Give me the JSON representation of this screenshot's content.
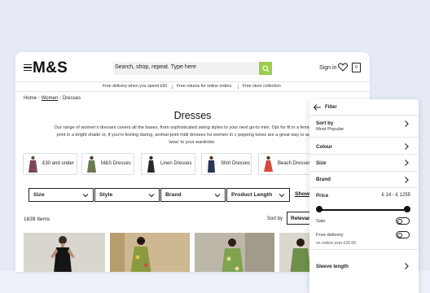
{
  "header": {
    "logo": "M&S",
    "search_placeholder": "Search, shop, repeat. Type here",
    "sign_in": "Sign in",
    "bag_count": "0"
  },
  "info_bar": [
    "Free delivery when you spend £60",
    "Free returns for online orders",
    "Free store collection"
  ],
  "breadcrumb": [
    "Home",
    "Women",
    "Dresses"
  ],
  "page": {
    "title": "Dresses",
    "description": "Our range of women's dresses covers all the bases, from sophisticated swing styles to your next go-to mini. Opt for fit in a feminine floral print in a bright shade or, if you're feeling daring, animal-print midi dresses for women in c popping tones are a great way to add a little 'wow' to your wardrobe"
  },
  "category_chips": [
    {
      "label": "£30 and under",
      "color": "#7a4a55"
    },
    {
      "label": "M&S Dresses",
      "color": "#6b7a4e"
    },
    {
      "label": "Linen Dresses",
      "color": "#2b2622"
    },
    {
      "label": "Shirt Dresses",
      "color": "#2a3556"
    },
    {
      "label": "Beach Dresses",
      "color": "#d84a3c"
    }
  ],
  "filters": [
    "Size",
    "Style",
    "Brand",
    "Product Length"
  ],
  "show_all_label": "Show",
  "results": {
    "count_text": "1839 Items",
    "sort_label": "Sort by",
    "sort_value": "Relevance"
  },
  "products": [
    {
      "color": "#c8c4bd"
    },
    {
      "color": "#c9b58f"
    },
    {
      "color": "#b8b2a6"
    },
    {
      "color": "#d7d2c8"
    }
  ],
  "filter_panel": {
    "title": "Filter",
    "sort_by_label": "Sort by",
    "sort_by_value": "Most Popular",
    "colour_label": "Colour",
    "size_label": "Size",
    "brand_label": "Brand",
    "price_label": "Price",
    "price_range": "£ 14 - £ 1255",
    "sale_label": "Sale",
    "free_delivery_label": "Free delivery",
    "free_delivery_sub": "on orders over £35.00",
    "sleeve_label": "Sleeve length"
  },
  "colors": {
    "accent_green": "#9bcc4a",
    "background": "#e6eaf6"
  }
}
